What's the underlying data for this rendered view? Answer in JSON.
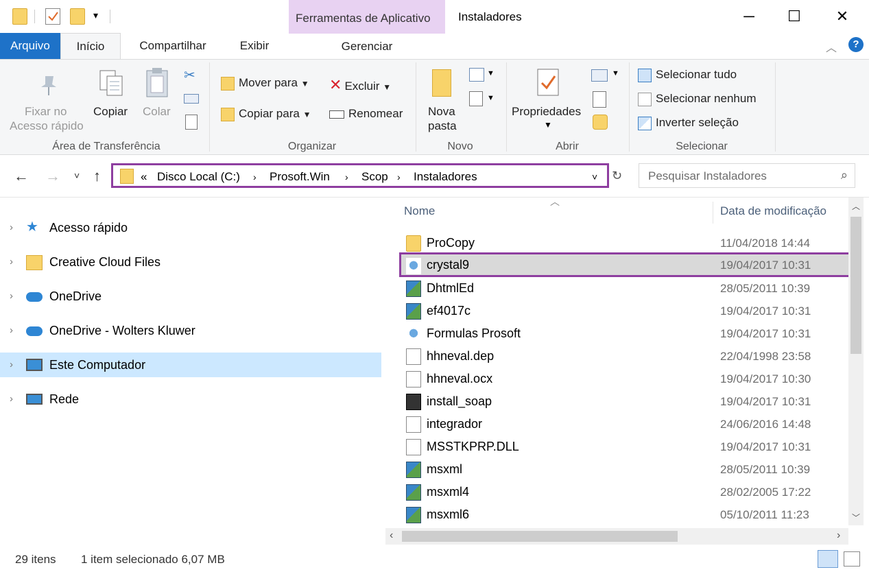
{
  "window": {
    "title": "Instaladores",
    "contextual_tab_group": "Ferramentas de Aplicativo",
    "minimize": "─",
    "maximize": "☐",
    "close": "✕"
  },
  "tabs": {
    "file": "Arquivo",
    "home": "Início",
    "share": "Compartilhar",
    "view": "Exibir",
    "manage": "Gerenciar"
  },
  "ribbon": {
    "clipboard": {
      "pin_line1": "Fixar no",
      "pin_line2": "Acesso rápido",
      "copy": "Copiar",
      "paste": "Colar",
      "group": "Área de Transferência"
    },
    "organize": {
      "move_to": "Mover para",
      "copy_to": "Copiar para",
      "delete": "Excluir",
      "rename": "Renomear",
      "group": "Organizar"
    },
    "new": {
      "new_folder_line1": "Nova",
      "new_folder_line2": "pasta",
      "group": "Novo"
    },
    "open": {
      "properties": "Propriedades",
      "group": "Abrir"
    },
    "select": {
      "select_all": "Selecionar tudo",
      "select_none": "Selecionar nenhum",
      "invert": "Inverter seleção",
      "group": "Selecionar"
    }
  },
  "address": {
    "overflow": "«",
    "crumbs": [
      "Disco Local (C:)",
      "Prosoft.Win",
      "Scop",
      "Instaladores"
    ]
  },
  "search": {
    "placeholder": "Pesquisar Instaladores"
  },
  "nav_pane": {
    "items": [
      {
        "label": "Acesso rápido",
        "icon": "star-icon"
      },
      {
        "label": "Creative Cloud Files",
        "icon": "creative-cloud-folder-icon"
      },
      {
        "label": "OneDrive",
        "icon": "cloud-icon"
      },
      {
        "label": "OneDrive - Wolters Kluwer",
        "icon": "cloud-business-icon"
      },
      {
        "label": "Este Computador",
        "icon": "computer-icon"
      },
      {
        "label": "Rede",
        "icon": "network-icon"
      }
    ],
    "selected_index": 4
  },
  "file_list": {
    "columns": {
      "name": "Nome",
      "date": "Data de modificação"
    },
    "rows": [
      {
        "name": "ProCopy",
        "date": "11/04/2018 14:44",
        "icon": "folder"
      },
      {
        "name": "crystal9",
        "date": "19/04/2017 10:31",
        "icon": "crystal"
      },
      {
        "name": "DhtmlEd",
        "date": "28/05/2011 10:39",
        "icon": "setup"
      },
      {
        "name": "ef4017c",
        "date": "19/04/2017 10:31",
        "icon": "setup"
      },
      {
        "name": "Formulas Prosoft",
        "date": "19/04/2017 10:31",
        "icon": "crystal"
      },
      {
        "name": "hhneval.dep",
        "date": "22/04/1998 23:58",
        "icon": "doc"
      },
      {
        "name": "hhneval.ocx",
        "date": "19/04/2017 10:30",
        "icon": "gear"
      },
      {
        "name": "install_soap",
        "date": "19/04/2017 10:31",
        "icon": "batch"
      },
      {
        "name": "integrador",
        "date": "24/06/2016 14:48",
        "icon": "doc"
      },
      {
        "name": "MSSTKPRP.DLL",
        "date": "19/04/2017 10:31",
        "icon": "gear"
      },
      {
        "name": "msxml",
        "date": "28/05/2011 10:39",
        "icon": "setup"
      },
      {
        "name": "msxml4",
        "date": "28/02/2005 17:22",
        "icon": "setup"
      },
      {
        "name": "msxml6",
        "date": "05/10/2011 11:23",
        "icon": "setup"
      }
    ],
    "selected_index": 1
  },
  "status": {
    "count": "29 itens",
    "selection": "1 item selecionado  6,07 MB"
  }
}
